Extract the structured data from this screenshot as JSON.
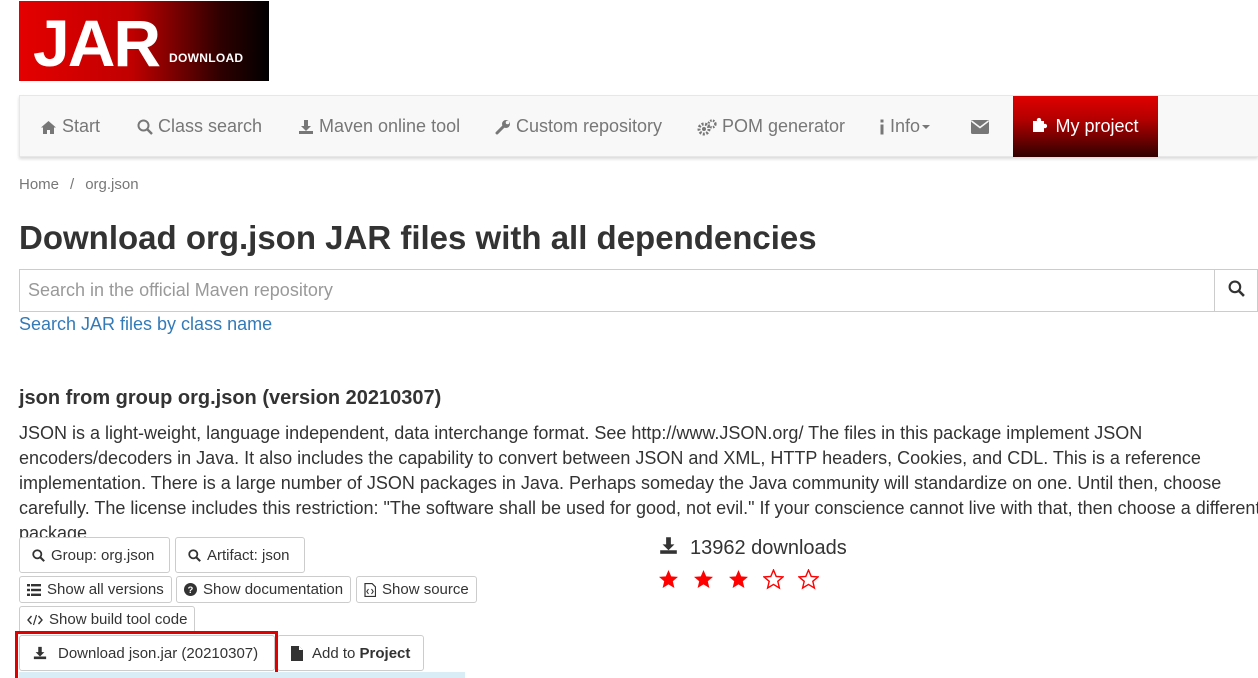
{
  "logo": {
    "main": "JAR",
    "sub": "DOWNLOAD"
  },
  "nav": {
    "start": "Start",
    "class_search": "Class search",
    "maven_tool": "Maven online tool",
    "custom_repo": "Custom repository",
    "pom_generator": "POM generator",
    "info": "Info",
    "my_project": "My project"
  },
  "breadcrumb": {
    "home": "Home",
    "sep": "/",
    "current": "org.json"
  },
  "page_title": "Download org.json JAR files with all dependencies",
  "search": {
    "placeholder": "Search in the official Maven repository",
    "value": ""
  },
  "class_link": "Search JAR files by class name",
  "artifact": {
    "heading": "json from group org.json (version 20210307)",
    "description": "JSON is a light-weight, language independent, data interchange format. See http://www.JSON.org/ The files in this package implement JSON encoders/decoders in Java. It also includes the capability to convert between JSON and XML, HTTP headers, Cookies, and CDL. This is a reference implementation. There is a large number of JSON packages in Java. Perhaps someday the Java community will standardize on one. Until then, choose carefully. The license includes this restriction: \"The software shall be used for good, not evil.\" If your conscience cannot live with that, then choose a different package."
  },
  "buttons": {
    "group": "Group: org.json",
    "artifact": "Artifact: json",
    "versions": "Show all versions",
    "documentation": "Show documentation",
    "source": "Show source",
    "build_tool": "Show build tool code",
    "download": "Download json.jar (20210307)",
    "add_prefix": "Add to ",
    "add_bold": "Project"
  },
  "stats": {
    "downloads": "13962 downloads",
    "rating": 3,
    "rating_max": 5
  },
  "colors": {
    "brand_red": "#e00000",
    "link": "#337ab7",
    "star": "#ff0000"
  }
}
